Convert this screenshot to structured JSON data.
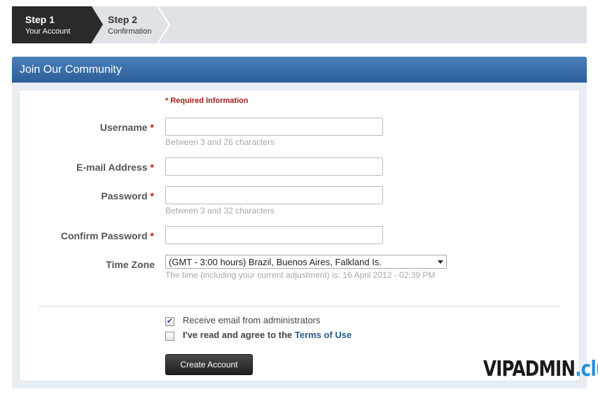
{
  "steps": [
    {
      "title": "Step 1",
      "subtitle": "Your Account"
    },
    {
      "title": "Step 2",
      "subtitle": "Confirmation"
    }
  ],
  "panel": {
    "title": "Join Our Community"
  },
  "form": {
    "required_note": "* Required Information",
    "required_marker": "*",
    "username": {
      "label": "Username",
      "value": "",
      "hint": "Between 3 and 26 characters"
    },
    "email": {
      "label": "E-mail Address",
      "value": ""
    },
    "password": {
      "label": "Password",
      "value": "",
      "hint": "Between 3 and 32 characters"
    },
    "confirm_password": {
      "label": "Confirm Password",
      "value": ""
    },
    "timezone": {
      "label": "Time Zone",
      "selected": "(GMT - 3:00 hours) Brazil, Buenos Aires, Falkland Is.",
      "hint": "The time (including your current adjustment) is: 16 April 2012 - 02:39 PM"
    },
    "receive_email": {
      "label": "Receive email from administrators",
      "checked": true
    },
    "agree_terms": {
      "label_prefix": "I've read and agree to the ",
      "link_text": "Terms of Use",
      "checked": false
    },
    "submit_label": "Create Account"
  },
  "watermark": {
    "main": "VIPADMIN",
    "suffix": ".club"
  },
  "colors": {
    "header_blue": "#2a5f99",
    "required_red": "#a01c1c",
    "link_blue": "#2a5a8a"
  }
}
